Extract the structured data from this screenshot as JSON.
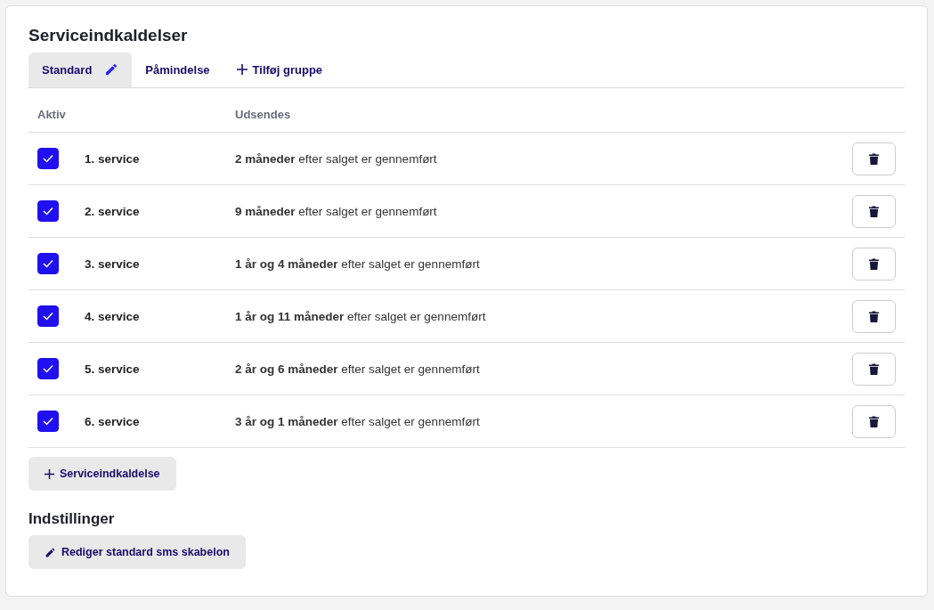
{
  "title": "Serviceindkaldelser",
  "tabs": [
    {
      "label": "Standard",
      "selected": true,
      "editable": true
    },
    {
      "label": "Påmindelse",
      "selected": false,
      "editable": false
    }
  ],
  "add_group": "Tilføj gruppe",
  "table": {
    "columns": [
      "Aktiv",
      "Udsendes"
    ],
    "rows": [
      {
        "checked": true,
        "name": "1. service",
        "sent": "**2 måneder** efter salget er gennemført"
      },
      {
        "checked": true,
        "name": "2. service",
        "sent": "**9 måneder** efter salget er gennemført"
      },
      {
        "checked": true,
        "name": "3. service",
        "sent": "**1 år og 4 måneder** efter salget er gennemført"
      },
      {
        "checked": true,
        "name": "4. service",
        "sent": "**1 år og 11 måneder** efter salget er gennemført"
      },
      {
        "checked": true,
        "name": "5. service",
        "sent": "**2 år og 6 måneder** efter salget er gennemført"
      },
      {
        "checked": true,
        "name": "6. service",
        "sent": "**3 år og 1 måneder** efter salget er gennemført"
      }
    ]
  },
  "add_button": "Serviceindkaldelse",
  "settings": {
    "title": "Indstillinger",
    "button": "Rediger standard sms skabelon"
  }
}
